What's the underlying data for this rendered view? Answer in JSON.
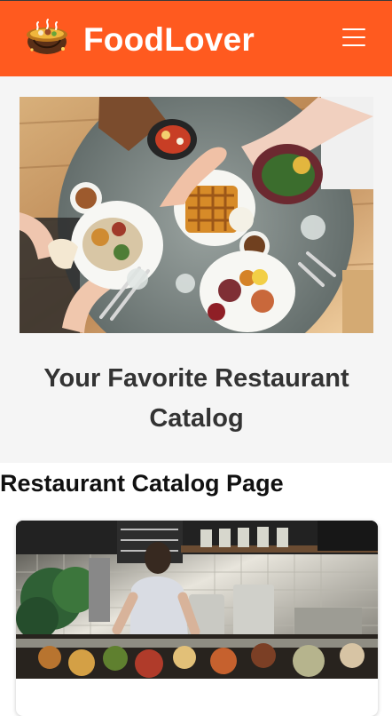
{
  "app": {
    "brand": "FoodLover"
  },
  "hero": {
    "title": "Your Favorite Restaurant Catalog"
  },
  "catalog": {
    "title": "Restaurant Catalog Page"
  },
  "colors": {
    "header": "#ff5a1f",
    "hero_background": "#f5f5f5",
    "title_text": "#333333"
  },
  "icons": {
    "logo": "food-pot-logo-icon",
    "menu": "hamburger-menu-icon"
  }
}
